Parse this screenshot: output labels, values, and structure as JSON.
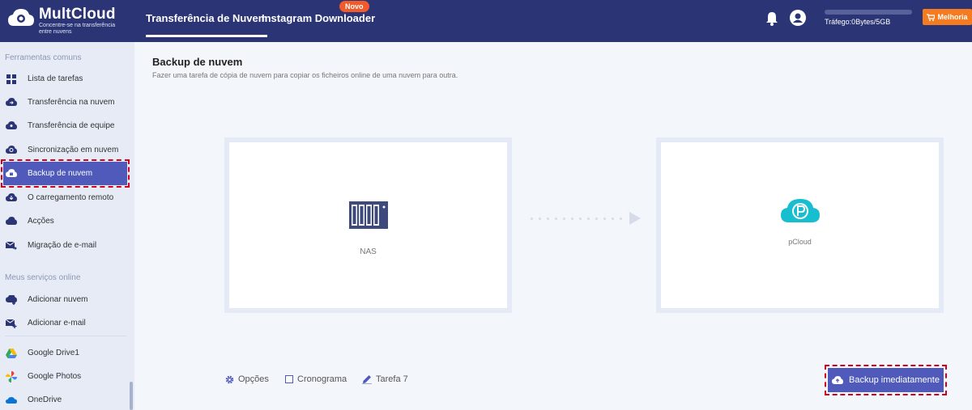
{
  "header": {
    "logo_title": "MultCloud",
    "logo_subtitle": "Concentre-se na transferência entre nuvens",
    "tabs": [
      {
        "label": "Transferência de Nuvem",
        "active": true
      },
      {
        "label": "Instagram Downloader",
        "active": false
      }
    ],
    "new_badge": "Novo",
    "traffic": "Tráfego:0Bytes/5GB",
    "upgrade_label": "Melhoria",
    "icons": [
      "bell-icon",
      "user-icon",
      "cart-icon"
    ]
  },
  "sidebar": {
    "section1_title": "Ferramentas comuns",
    "items": [
      {
        "label": "Lista de tarefas",
        "icon": "grid-icon"
      },
      {
        "label": "Transferência na nuvem",
        "icon": "cloud-transfer-icon"
      },
      {
        "label": "Transferência de equipe",
        "icon": "cloud-team-icon"
      },
      {
        "label": "Sincronização em nuvem",
        "icon": "cloud-sync-icon"
      },
      {
        "label": "Backup de nuvem",
        "icon": "cloud-backup-icon",
        "active": true
      },
      {
        "label": "O carregamento remoto",
        "icon": "cloud-download-icon"
      },
      {
        "label": "Acções",
        "icon": "cloud-actions-icon"
      },
      {
        "label": "Migração de e-mail",
        "icon": "email-migration-icon"
      }
    ],
    "section2_title": "Meus serviços online",
    "services": [
      {
        "label": "Adicionar nuvem",
        "icon": "cloud-add-icon"
      },
      {
        "label": "Adicionar e-mail",
        "icon": "email-add-icon"
      }
    ],
    "clouds": [
      {
        "label": "Google Drive1",
        "icon": "google-drive-icon"
      },
      {
        "label": "Google Photos",
        "icon": "google-photos-icon"
      },
      {
        "label": "OneDrive",
        "icon": "onedrive-icon"
      }
    ]
  },
  "main": {
    "title": "Backup de nuvem",
    "subtitle": "Fazer uma tarefa de cópia de nuvem para copiar os ficheiros online de uma nuvem para outra.",
    "source": {
      "label": "NAS",
      "icon": "nas-icon"
    },
    "target": {
      "label": "pCloud",
      "icon": "pcloud-icon"
    },
    "options_label": "Opções",
    "schedule_label": "Cronograma",
    "task_label": "Tarefa 7",
    "backup_button": "Backup imediatamente"
  },
  "colors": {
    "header_bg": "#2b3575",
    "accent": "#4f5aba",
    "upgrade": "#f47b20",
    "new_badge": "#f15a29",
    "highlight_dash": "#d0021b"
  }
}
